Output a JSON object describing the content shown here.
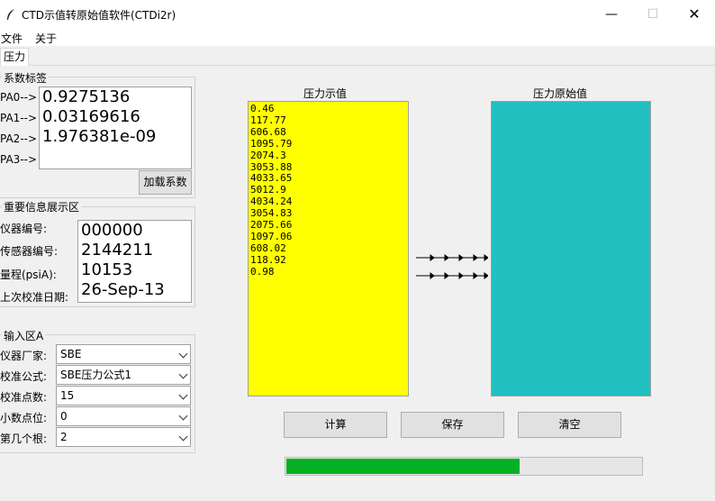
{
  "window": {
    "title": "CTD示值转原始值软件(CTDi2r)",
    "minimize_glyph": "—",
    "maximize_glyph": "☐",
    "close_glyph": "✕",
    "icon": "feather-icon"
  },
  "menu": {
    "items": [
      "文件",
      "关于"
    ]
  },
  "tabs": [
    {
      "label": "压力",
      "active": true
    }
  ],
  "coef_group": {
    "title": "系数标签",
    "labels": [
      "PA0-->",
      "PA1-->",
      "PA2-->",
      "PA3-->"
    ],
    "values": [
      "0.9275136",
      "0.03169616",
      "1.976381e-09",
      ""
    ],
    "load_button": "加载系数"
  },
  "info_group": {
    "title": "重要信息展示区",
    "labels": [
      "仪器编号:",
      "传感器编号:",
      "量程(psiA):",
      "上次校准日期:"
    ],
    "values": [
      "000000",
      "2144211",
      "10153",
      "26-Sep-13"
    ]
  },
  "input_group": {
    "title": "输入区A",
    "fields": [
      {
        "label": "仪器厂家:",
        "value": "SBE"
      },
      {
        "label": "校准公式:",
        "value": "SBE压力公式1"
      },
      {
        "label": "校准点数:",
        "value": "15"
      },
      {
        "label": "小数点位:",
        "value": "0"
      },
      {
        "label": "第几个根:",
        "value": "2"
      }
    ]
  },
  "pressure_display": {
    "title": "压力示值",
    "values": [
      "0.46",
      "117.77",
      "606.68",
      "1095.79",
      "2074.3",
      "3053.88",
      "4033.65",
      "5012.9",
      "4034.24",
      "3054.83",
      "2075.66",
      "1097.06",
      "608.02",
      "118.92",
      "0.98"
    ]
  },
  "raw_display": {
    "title": "压力原始值"
  },
  "buttons": {
    "compute": "计算",
    "save": "保存",
    "clear": "清空"
  },
  "progress": {
    "fraction": 0.66
  },
  "colors": {
    "yellow": "#ffff00",
    "teal": "#22c0c0",
    "progress": "#06b025"
  }
}
